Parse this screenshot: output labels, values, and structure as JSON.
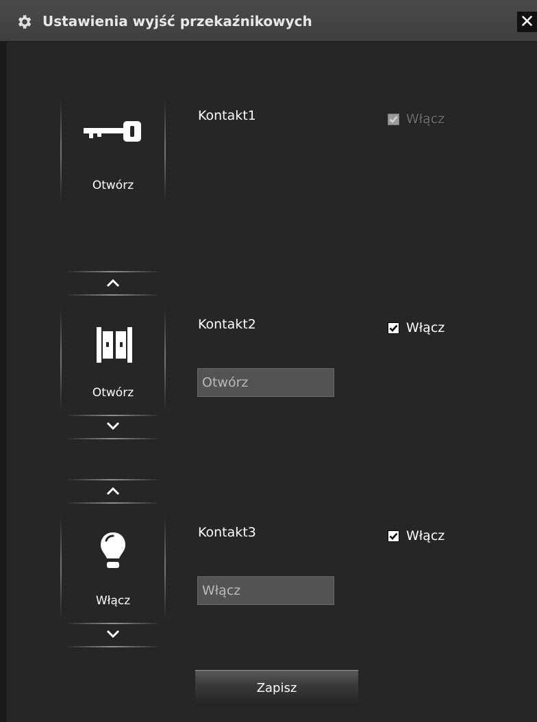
{
  "window": {
    "title": "Ustawienia wyjść przekaźnikowych",
    "close_glyph": "✕",
    "title_icon": "gear-icon",
    "close_icon": "close-icon"
  },
  "contacts": [
    {
      "name": "Kontakt1",
      "icon": "key-icon",
      "action_caption": "Otwórz",
      "enable_label": "Włącz",
      "enabled": true,
      "checkbox_disabled": true,
      "text_field": null,
      "has_up_arrow": false,
      "has_down_arrow": false
    },
    {
      "name": "Kontakt2",
      "icon": "door-icon",
      "action_caption": "Otwórz",
      "enable_label": "Włącz",
      "enabled": true,
      "checkbox_disabled": false,
      "text_field": "Otwórz",
      "has_up_arrow": true,
      "has_down_arrow": true
    },
    {
      "name": "Kontakt3",
      "icon": "lightbulb-icon",
      "action_caption": "Włącz",
      "enable_label": "Włącz",
      "enabled": true,
      "checkbox_disabled": false,
      "text_field": "Włącz",
      "has_up_arrow": true,
      "has_down_arrow": true
    }
  ],
  "footer": {
    "save_label": "Zapisz"
  },
  "colors": {
    "background": "#262626",
    "titlebar": "#444444",
    "text": "#ffffff",
    "field_bg": "#535353",
    "disabled_text": "#6e6e6e"
  }
}
